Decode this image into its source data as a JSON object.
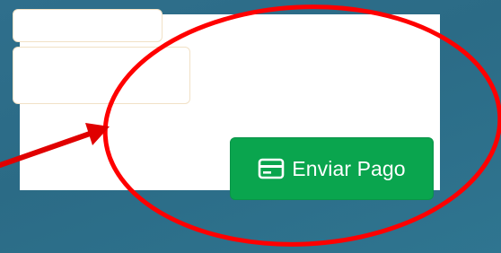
{
  "form": {
    "pay_button": {
      "label": "Enviar Pago",
      "icon": "credit-card-icon",
      "color": "#0aa54e"
    }
  },
  "annotation": {
    "color": "#ff0000"
  }
}
